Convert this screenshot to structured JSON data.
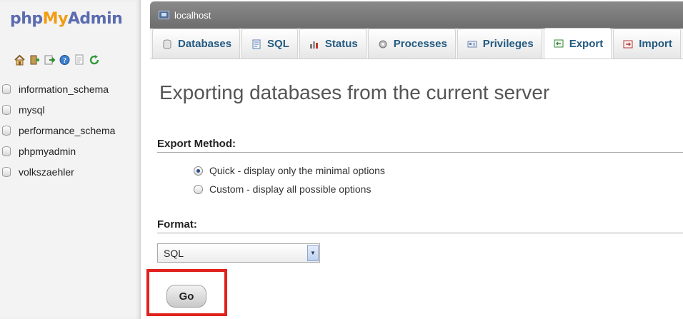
{
  "app": {
    "logo": {
      "php": "php",
      "my": "My",
      "admin": "Admin"
    }
  },
  "nav": {
    "icons": [
      "home-icon",
      "logout-icon",
      "query-window-icon",
      "help-icon",
      "docs-icon",
      "reload-icon"
    ],
    "databases": [
      {
        "label": "information_schema"
      },
      {
        "label": "mysql"
      },
      {
        "label": "performance_schema"
      },
      {
        "label": "phpmyadmin"
      },
      {
        "label": "volkszaehler"
      }
    ]
  },
  "breadcrumb": {
    "server": "localhost"
  },
  "tabs": [
    {
      "label": "Databases",
      "icon": "database-icon",
      "active": false
    },
    {
      "label": "SQL",
      "icon": "sql-icon",
      "active": false
    },
    {
      "label": "Status",
      "icon": "status-icon",
      "active": false
    },
    {
      "label": "Processes",
      "icon": "processes-icon",
      "active": false
    },
    {
      "label": "Privileges",
      "icon": "privileges-icon",
      "active": false
    },
    {
      "label": "Export",
      "icon": "export-icon",
      "active": true
    },
    {
      "label": "Import",
      "icon": "import-icon",
      "active": false
    }
  ],
  "page": {
    "title": "Exporting databases from the current server",
    "export_method": {
      "heading": "Export Method:",
      "options": [
        {
          "label": "Quick - display only the minimal options",
          "checked": true
        },
        {
          "label": "Custom - display all possible options",
          "checked": false
        }
      ]
    },
    "format": {
      "heading": "Format:",
      "selected": "SQL"
    },
    "go_label": "Go"
  },
  "colors": {
    "tab_text": "#235a81",
    "topbar": "#7a7a7a",
    "highlight": "#e0211d",
    "logo_blue": "#5b6cb0",
    "logo_orange": "#f39c12"
  }
}
